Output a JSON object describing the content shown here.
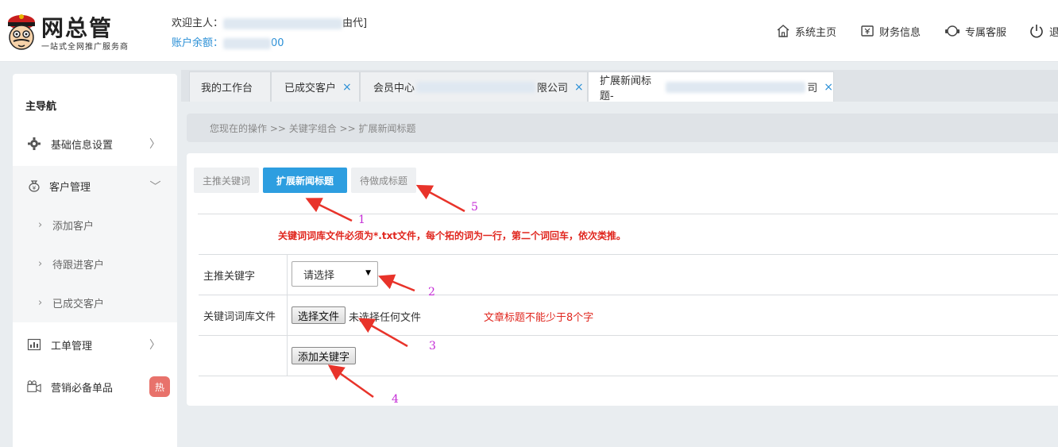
{
  "header": {
    "logo_title": "网总管",
    "logo_subtitle": "一站式全网推广服务商",
    "welcome_prefix": "欢迎主人：",
    "welcome_suffix": "由代]",
    "balance_label": "账户余额：",
    "balance_suffix": "00",
    "nav": [
      {
        "label": "系统主页",
        "icon": "home-icon"
      },
      {
        "label": "财务信息",
        "icon": "finance-icon"
      },
      {
        "label": "专属客服",
        "icon": "support-icon"
      },
      {
        "label": "退",
        "icon": "power-icon"
      }
    ]
  },
  "sidebar": {
    "title": "主导航",
    "items": [
      {
        "label": "基础信息设置",
        "icon": "gear-icon"
      },
      {
        "label": "客户管理",
        "icon": "money-bag-icon"
      },
      {
        "label": "工单管理",
        "icon": "chart-icon"
      },
      {
        "label": "营销必备单品",
        "icon": "camera-icon",
        "badge": "热"
      }
    ],
    "sub_items": [
      "添加客户",
      "待跟进客户",
      "已成交客户"
    ]
  },
  "tabs": [
    {
      "label": "我的工作台",
      "closable": false
    },
    {
      "label": "已成交客户",
      "closable": true
    },
    {
      "label": "会员中心",
      "suffix": "限公司",
      "closable": true
    },
    {
      "label": "扩展新闻标题-",
      "suffix": "司",
      "closable": true,
      "active": true
    }
  ],
  "breadcrumb": "您现在的操作 >> 关键字组合 >> 扩展新闻标题",
  "subtabs": [
    "主推关键词",
    "扩展新闻标题",
    "待做成标题"
  ],
  "form": {
    "notice": "关键词词库文件必须为*.txt文件，每个拓的词为一行，第二个词回车，依次类推。",
    "keyword_label": "主推关键字",
    "select_value": "请选择",
    "file_label": "关键词词库文件",
    "file_button": "选择文件",
    "file_status": "未选择任何文件",
    "warning": "文章标题不能少于8个字",
    "add_button": "添加关键字"
  },
  "annotations": [
    "1",
    "2",
    "3",
    "4",
    "5"
  ],
  "colors": {
    "accent": "#2d9ee0",
    "warning": "#e0261e",
    "annotation": "#c42ad6",
    "arrow": "#e8332a"
  }
}
